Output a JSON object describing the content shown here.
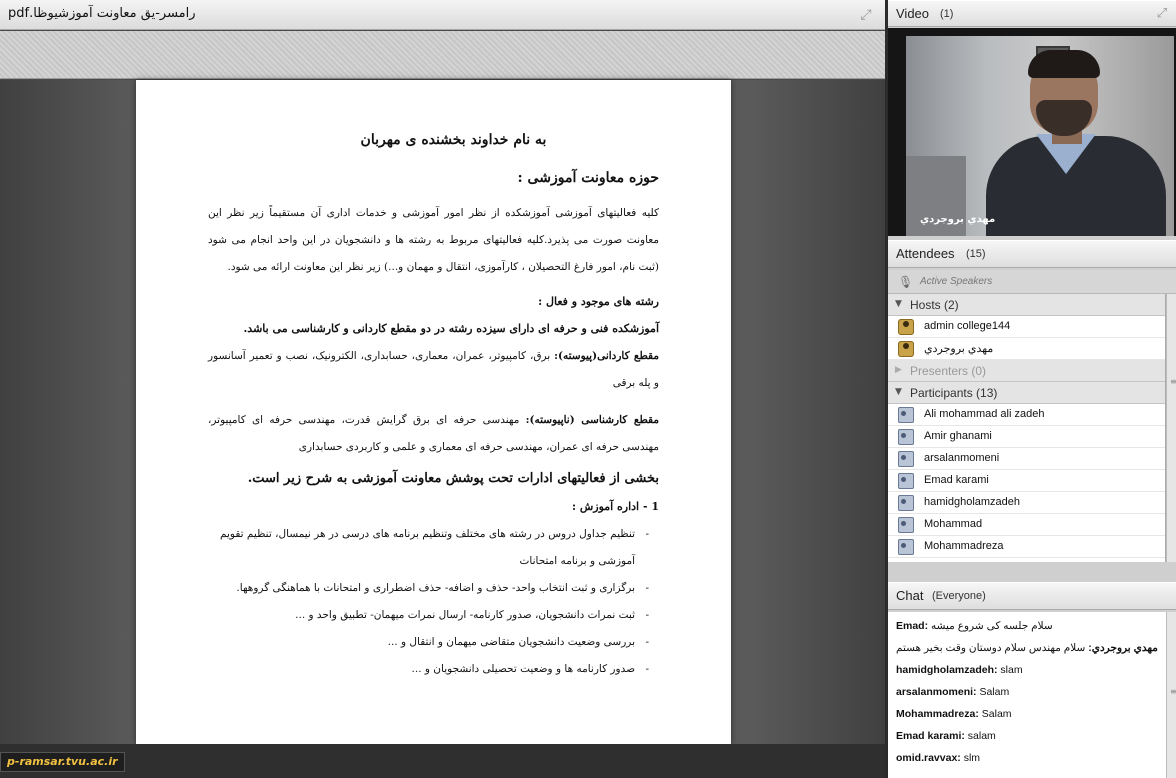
{
  "document": {
    "filename": "رامسر-یق معاونت آموزشیوظا.pdf",
    "heading_basmala": "به نام خداوند بخشنده ی مهربان",
    "heading_section": "حوزه معاونت آموزشی :",
    "para1": "کلیه فعالیتهای آموزشی آموزشکده از نظر امور آموزشی و خدمات اداری آن مستقیماً زیر نظر این معاونت صورت می پذیرد.کلیه فعالیتهای مربوط به رشته ها و دانشجویان در این واحد انجام می شود (ثبت نام، امور فارغ التحصیلان ، کارآموزی، انتقال و مهمان و...) زیر نظر این معاونت ارائه می شود.",
    "fields_heading": "رشته های موجود و فعال :",
    "fields_intro": "آموزشکده فنی و حرفه ای دارای سیزده رشته در دو مقطع کاردانی و کارشناسی می باشد.",
    "associate_label": "مقطع کاردانی(پیوسته):",
    "associate_text": " برق، کامپیوتر، عمران، معماری، حسابداری، الکترونیک، نصب و تعمیر آسانسور و پله برقی",
    "bachelor_label": "مقطع کارشناسی (ناپیوسته):",
    "bachelor_text": " مهندسی حرفه ای برق گرایش قدرت، مهندسی حرفه ای کامپیوتر، مهندسی حرفه ای عمران، مهندسی حرفه ای معماری و علمی و کاربردی حسابداری",
    "activities_heading": "بخشی از فعالیتهای ادارات تحت پوشش معاونت آموزشی به شرح زیر است.",
    "office_heading": "1 - اداره آموزش :",
    "bullets": [
      "تنظیم جداول دروس در رشته های مختلف وتنظیم برنامه های درسی در هر نیمسال، تنظیم تقویم آموزشی و برنامه امتحانات",
      "برگزاری و ثبت انتخاب واحد- حذف و اضافه- حذف اضطراری و امتحانات با هماهنگی گروهها.",
      "ثبت نمرات دانشجویان، صدور کارنامه- ارسال نمرات میهمان- تطبیق واحد و ...",
      "بررسی وضعیت دانشجویان متقاضی میهمان و انتقال و ...",
      "صدور کارنامه ها و وضعیت تحصیلی دانشجویان و ..."
    ],
    "footer_logo": "p-ramsar.tvu.ac.ir"
  },
  "video": {
    "title": "Video",
    "count": "(1)",
    "presenter_name": "مهدي بروجردي"
  },
  "attendees": {
    "title": "Attendees",
    "count": "(15)",
    "active_speakers": "Active Speakers",
    "hosts_label": "Hosts (2)",
    "hosts": [
      "admin college144",
      "مهدي بروجردي"
    ],
    "presenters_label": "Presenters (0)",
    "participants_label": "Participants (13)",
    "participants": [
      "Ali mohammad ali zadeh",
      "Amir ghanami",
      "arsalanmomeni",
      "Emad karami",
      "hamidgholamzadeh",
      "Mohammad",
      "Mohammadreza"
    ]
  },
  "chat": {
    "title": "Chat",
    "scope": "(Everyone)",
    "messages": [
      {
        "sender": "Emad:",
        "text": " سلام جلسه کی شروع میشه"
      },
      {
        "sender": "مهدي بروجردي:",
        "text": " سلام مهندس سلام دوستان وقت بخیر هستم"
      },
      {
        "sender": "hamidgholamzadeh:",
        "text": " slam"
      },
      {
        "sender": "arsalanmomeni:",
        "text": " Salam"
      },
      {
        "sender": "Mohammadreza:",
        "text": " Salam"
      },
      {
        "sender": "Emad karami:",
        "text": " salam"
      },
      {
        "sender": "omid.ravvax:",
        "text": " slm"
      }
    ]
  }
}
